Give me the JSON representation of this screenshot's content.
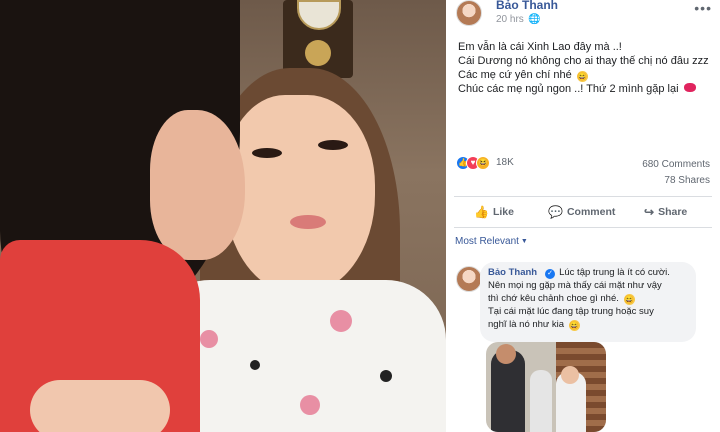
{
  "post": {
    "author": "Bảo Thanh",
    "time": "20 hrs",
    "more_label": "•••",
    "lines": [
      "Em vẫn là cái Xinh Lao đây mà ..!",
      "Cái Dương nó không cho ai thay thế chị nó đâu zzz",
      "Các mẹ cứ yên chí nhé",
      "Chúc các mẹ ngủ ngon ..! Thứ 2 mình gặp lại"
    ],
    "reaction_count": "18K",
    "comments": "680 Comments",
    "shares": "78 Shares"
  },
  "actions": {
    "like": "Like",
    "comment": "Comment",
    "share": "Share"
  },
  "sort": {
    "label": "Most Relevant"
  },
  "comment": {
    "author": "Bảo Thanh",
    "lines": [
      "Lúc tập trung là ít có cười.",
      "Nên mọi ng gặp mà thấy cái mặt như vậy",
      "thì chớ kêu chảnh choe gì nhé.",
      "Tại cái mặt lúc đang tập trung hoặc suy",
      "nghĩ là nó như kia"
    ]
  },
  "icons": {
    "globe": "globe-icon",
    "like": "thumbs-up-icon",
    "comment": "speech-bubble-icon",
    "share": "share-arrow-icon",
    "verified": "verified-badge-icon"
  },
  "colors": {
    "link": "#385898",
    "like_blue": "#1877f2",
    "love_red": "#f33e58"
  }
}
